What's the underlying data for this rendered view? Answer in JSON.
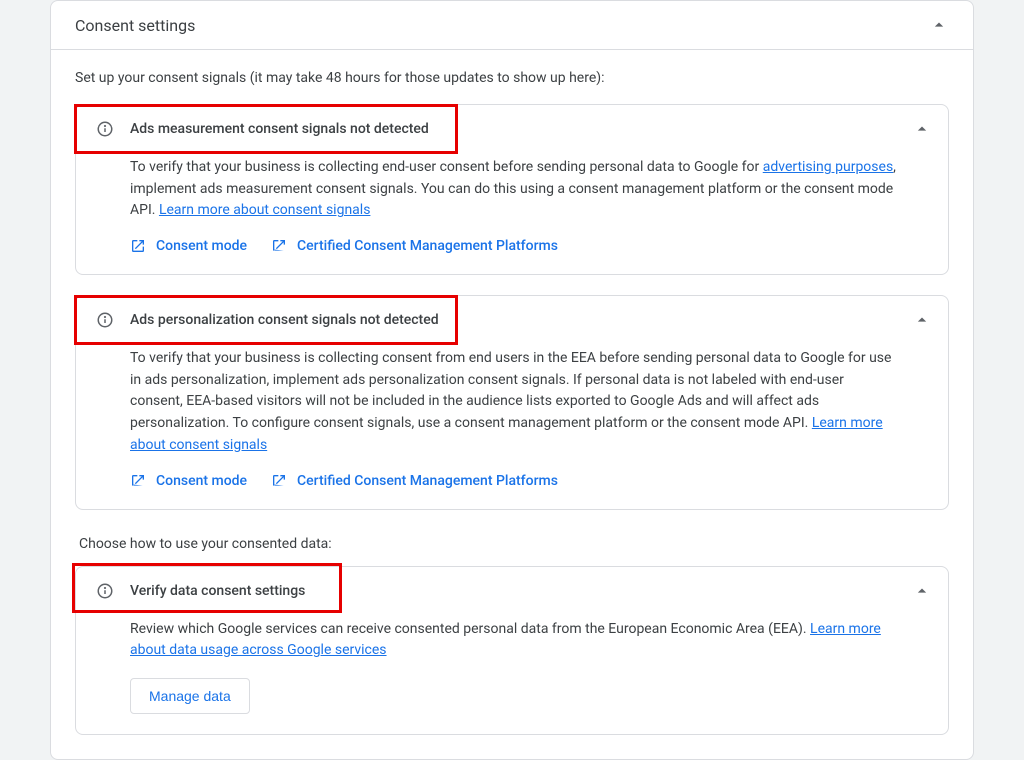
{
  "card": {
    "title": "Consent settings"
  },
  "intro": "Set up your consent signals (it may take 48 hours for those updates to show up here):",
  "section1": {
    "title": "Ads measurement consent signals not detected",
    "desc_part1": "To verify that your business is collecting end-user consent before sending personal data to Google for ",
    "link1": "advertising purposes",
    "desc_part2": ", implement ads measurement consent signals. You can do this using a consent management platform or the consent mode API. ",
    "link2": "Learn more about consent signals",
    "action1": "Consent mode",
    "action2": "Certified Consent Management Platforms"
  },
  "section2": {
    "title": "Ads personalization consent signals not detected",
    "desc_part1": "To verify that your business is collecting consent from end users in the EEA before sending personal data to Google for use in ads personalization, implement ads personalization consent signals. If personal data is not labeled with end-user consent, EEA-based visitors will not be included in the audience lists exported to Google Ads and will affect ads personalization. To configure consent signals, use a consent management platform or the consent mode API. ",
    "link1": "Learn more about consent signals",
    "action1": "Consent mode",
    "action2": "Certified Consent Management Platforms"
  },
  "chooseLabel": "Choose how to use your consented data:",
  "section3": {
    "title": "Verify data consent settings",
    "desc_part1": "Review which Google services can receive consented personal data from the European Economic Area (EEA). ",
    "link1": "Learn more about data usage across Google services",
    "button": "Manage data"
  }
}
